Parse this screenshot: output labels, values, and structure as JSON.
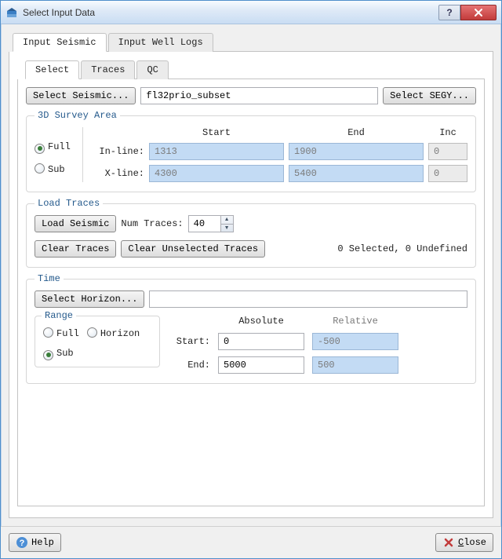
{
  "window": {
    "title": "Select Input Data"
  },
  "outer_tabs": {
    "seismic": "Input Seismic",
    "well_logs": "Input Well Logs"
  },
  "inner_tabs": {
    "select": "Select",
    "traces": "Traces",
    "qc": "QC"
  },
  "seismic_row": {
    "select_seismic_btn": "Select Seismic...",
    "seismic_name": "fl32prio_subset",
    "select_segy_btn": "Select SEGY..."
  },
  "survey": {
    "legend": "3D Survey Area",
    "full_label": "Full",
    "sub_label": "Sub",
    "col_start": "Start",
    "col_end": "End",
    "col_inc": "Inc",
    "inline_label": "In-line:",
    "xline_label": "X-line:",
    "inline_start": "1313",
    "inline_end": "1900",
    "inline_inc": "0",
    "xline_start": "4300",
    "xline_end": "5400",
    "xline_inc": "0"
  },
  "load": {
    "legend": "Load Traces",
    "load_seismic_btn": "Load Seismic",
    "num_traces_label": "Num Traces:",
    "num_traces_value": "40",
    "clear_traces_btn": "Clear Traces",
    "clear_unselected_btn": "Clear Unselected Traces",
    "status": "0 Selected, 0 Undefined"
  },
  "time": {
    "legend": "Time",
    "select_horizon_btn": "Select Horizon...",
    "horizon_value": "",
    "range_legend": "Range",
    "full_label": "Full",
    "horizon_label": "Horizon",
    "sub_label": "Sub",
    "abs_header": "Absolute",
    "rel_header": "Relative",
    "start_label": "Start:",
    "end_label": "End:",
    "abs_start": "0",
    "abs_end": "5000",
    "rel_start": "-500",
    "rel_end": "500"
  },
  "bottom": {
    "help_label": "Help",
    "close_label": "Close"
  }
}
